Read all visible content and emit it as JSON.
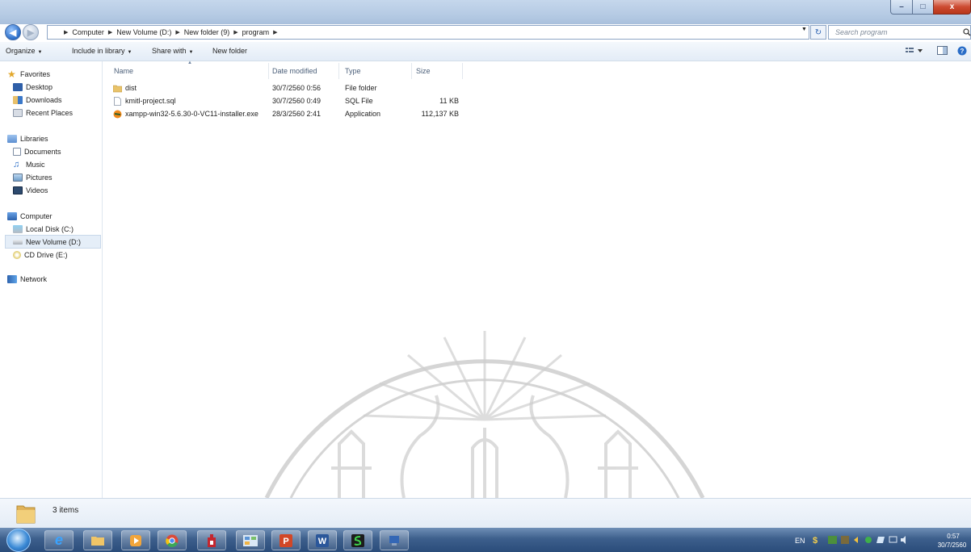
{
  "window": {
    "minimize_label": "–",
    "maximize_label": "□",
    "close_label": "x"
  },
  "address": {
    "crumbs": [
      "Computer",
      "New Volume (D:)",
      "New folder (9)",
      "program"
    ]
  },
  "search": {
    "placeholder": "Search program"
  },
  "toolbar": {
    "organize": "Organize",
    "include": "Include in library",
    "share": "Share with",
    "new_folder": "New folder"
  },
  "nav": {
    "favorites": "Favorites",
    "desktop": "Desktop",
    "downloads": "Downloads",
    "recent": "Recent Places",
    "libraries": "Libraries",
    "documents": "Documents",
    "music": "Music",
    "pictures": "Pictures",
    "videos": "Videos",
    "computer": "Computer",
    "local_disk": "Local Disk (C:)",
    "new_volume": "New Volume (D:)",
    "cd_drive": "CD Drive (E:)",
    "network": "Network"
  },
  "columns": {
    "name": "Name",
    "date": "Date modified",
    "type": "Type",
    "size": "Size"
  },
  "files": [
    {
      "name": "dist",
      "date": "30/7/2560 0:56",
      "type": "File folder",
      "size": ""
    },
    {
      "name": "kmitl-project.sql",
      "date": "30/7/2560 0:49",
      "type": "SQL File",
      "size": "11 KB"
    },
    {
      "name": "xampp-win32-5.6.30-0-VC11-installer.exe",
      "date": "28/3/2560 2:41",
      "type": "Application",
      "size": "112,137 KB"
    }
  ],
  "details": {
    "count": "3 items"
  },
  "taskbar": {
    "apps": [
      "ie-icon",
      "explorer-icon",
      "media-player-icon",
      "chrome-icon",
      "tower-app-icon",
      "control-panel-icon",
      "powerpoint-icon",
      "word-icon",
      "terminal-icon",
      "network-app-icon"
    ],
    "lang": "EN",
    "time": "0:57",
    "date": "30/7/2560"
  },
  "colors": {
    "accent": "#2a6dc7",
    "taskbar": "#3d5f8c"
  }
}
